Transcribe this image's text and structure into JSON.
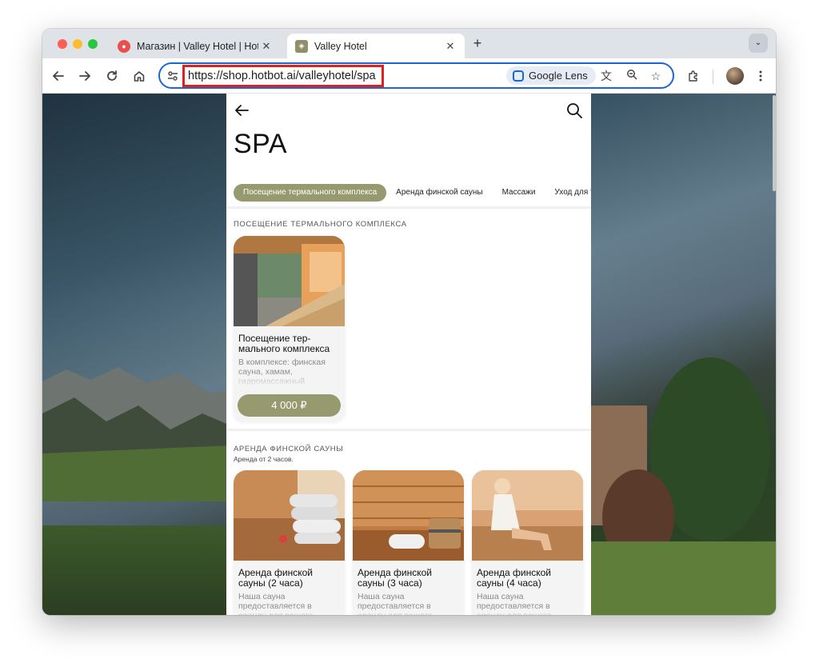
{
  "browser": {
    "tabs": [
      {
        "title": "Магазин | Valley Hotel | Hotbot",
        "active": false,
        "favicon": "hotbot-flame-icon"
      },
      {
        "title": "Valley Hotel",
        "active": true,
        "favicon": "valley-hotel-icon"
      }
    ],
    "new_tab_label": "+",
    "url": "https://shop.hotbot.ai/valleyhotel/spa",
    "lens_label": "Google Lens"
  },
  "page": {
    "title": "SPA",
    "categories": [
      "Посещение термального комплекса",
      "Аренда финской сауны",
      "Массажи",
      "Уход для т"
    ],
    "sections": [
      {
        "title": "Посещение термального комплекса",
        "products": [
          {
            "name": "Посещение тер-мального комплекса",
            "description": "В комплексе: финская сауна, хамам, гидромассажный",
            "price": "4 000 ₽"
          }
        ]
      },
      {
        "title": "Аренда финской сауны",
        "subtitle": "Аренда от 2 часов.",
        "products": [
          {
            "name": "Аренда финской сауны (2 часа)",
            "description": "Наша сауна предоставляется в аренду для вашего"
          },
          {
            "name": "Аренда финской сауны (3 часа)",
            "description": "Наша сауна предоставляется в аренду для вашего"
          },
          {
            "name": "Аренда финской сауны (4 часа)",
            "description": "Наша сауна предоставляется в аренду для вашего"
          }
        ]
      }
    ]
  },
  "colors": {
    "accent": "#969a6e",
    "highlight": "#e0201b",
    "omnibox_border": "#1a66d2"
  }
}
